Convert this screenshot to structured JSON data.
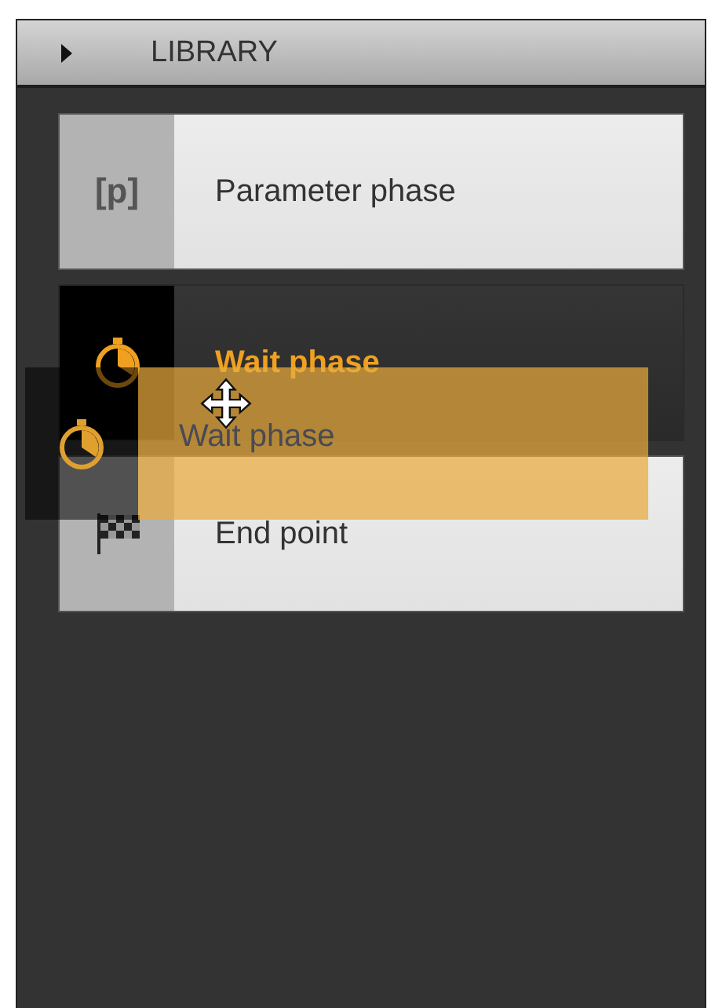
{
  "library": {
    "title": "LIBRARY",
    "expanded": false
  },
  "items": [
    {
      "kind": "parameter",
      "icon_text": "[p]",
      "label": "Parameter phase",
      "selected": false
    },
    {
      "kind": "wait",
      "label": "Wait phase",
      "selected": true
    },
    {
      "kind": "end",
      "label": "End point",
      "selected": false
    }
  ],
  "drag_ghost": {
    "kind": "wait",
    "label": "Wait phase"
  }
}
